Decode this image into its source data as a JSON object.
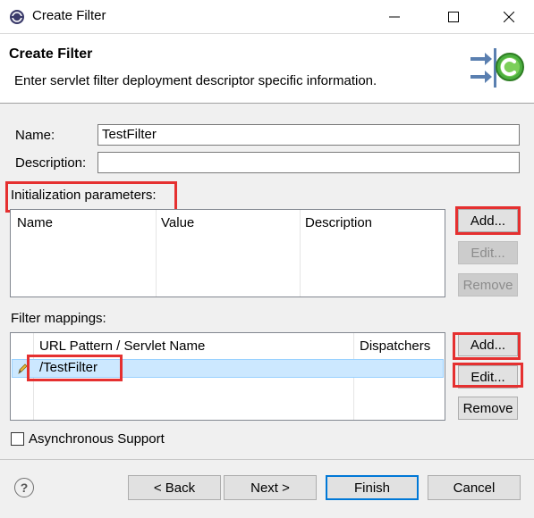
{
  "window": {
    "title": "Create Filter"
  },
  "header": {
    "title": "Create Filter",
    "description": "Enter servlet filter deployment descriptor specific information."
  },
  "form": {
    "name_label": "Name:",
    "name_value": "TestFilter",
    "description_label": "Description:",
    "description_value": ""
  },
  "init_params": {
    "label": "Initialization parameters:",
    "columns": [
      "Name",
      "Value",
      "Description"
    ],
    "rows": [],
    "add_label": "Add...",
    "edit_label": "Edit...",
    "remove_label": "Remove"
  },
  "filter_mappings": {
    "label": "Filter mappings:",
    "columns": [
      "URL Pattern / Servlet Name",
      "Dispatchers"
    ],
    "rows": [
      {
        "pattern": "/TestFilter",
        "dispatchers": ""
      }
    ],
    "add_label": "Add...",
    "edit_label": "Edit...",
    "remove_label": "Remove"
  },
  "async": {
    "label": "Asynchronous Support",
    "checked": false
  },
  "footer": {
    "help_glyph": "?",
    "back_label": "< Back",
    "next_label": "Next >",
    "finish_label": "Finish",
    "cancel_label": "Cancel"
  },
  "colors": {
    "highlight": "#e53030",
    "selection": "#cce8ff",
    "accent": "#0078d7"
  }
}
